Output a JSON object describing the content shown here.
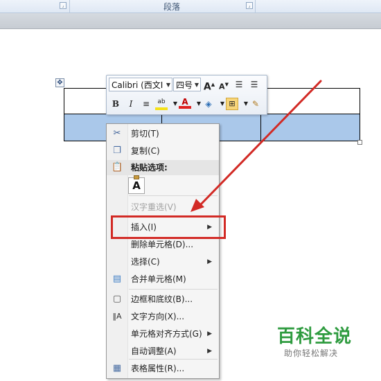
{
  "ribbon": {
    "group_label": "段落"
  },
  "mini_toolbar": {
    "font_name": "Calibri (西文Ⅰ",
    "font_size": "四号",
    "icons": [
      "grow-font-icon",
      "shrink-font-icon",
      "decrease-indent-icon",
      "increase-indent-icon",
      "bold-icon",
      "italic-icon",
      "center-align-icon",
      "highlight-icon",
      "font-color-icon",
      "shading-icon",
      "borders-icon",
      "format-painter-icon"
    ],
    "bold_label": "B",
    "italic_label": "I",
    "font_color_label": "A",
    "grow_label": "A",
    "shrink_label": "A",
    "highlight_label": "ab"
  },
  "context_menu": {
    "items": [
      {
        "label": "剪切(T)",
        "icon": "scissors-icon"
      },
      {
        "label": "复制(C)",
        "icon": "copy-icon"
      },
      {
        "label": "粘贴选项:",
        "icon": "paste-icon"
      },
      {
        "label": "汉字重选(V)",
        "icon": ""
      },
      {
        "label": "插入(I)",
        "icon": "",
        "submenu": true
      },
      {
        "label": "删除单元格(D)...",
        "icon": ""
      },
      {
        "label": "选择(C)",
        "icon": "",
        "submenu": true
      },
      {
        "label": "合并单元格(M)",
        "icon": "merge-cells-icon"
      },
      {
        "label": "边框和底纹(B)...",
        "icon": "borders-shading-icon"
      },
      {
        "label": "文字方向(X)...",
        "icon": "text-direction-icon"
      },
      {
        "label": "单元格对齐方式(G)",
        "icon": "",
        "submenu": true
      },
      {
        "label": "自动调整(A)",
        "icon": "",
        "submenu": true
      },
      {
        "label": "表格属性(R)...",
        "icon": "table-properties-icon"
      }
    ],
    "paste_option": "A"
  },
  "watermark": {
    "title": "百科全说",
    "subtitle": "助你轻松解决"
  },
  "colors": {
    "selection": "#aac8ea",
    "highlight_box": "#d22a25",
    "watermark_green": "#2e9b3f"
  }
}
